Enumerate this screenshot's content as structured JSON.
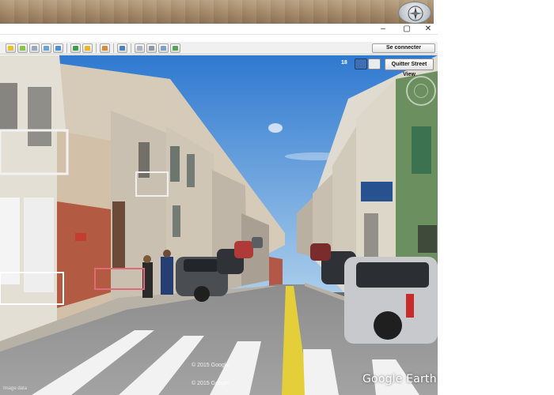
{
  "window": {
    "minimize_label": "–",
    "maximize_label": "▢",
    "close_label": "✕"
  },
  "toolbar": {
    "signin_label": "Se connecter",
    "icons": [
      "push-pin-icon",
      "polygon-icon",
      "path-icon",
      "image-overlay-icon",
      "tour-icon",
      "historical-imagery-icon",
      "sun-icon",
      "planets-icon",
      "ruler-icon",
      "email-icon",
      "print-icon",
      "save-image-icon",
      "google-maps-icon"
    ]
  },
  "streetview": {
    "zoom_level": "18",
    "exit_label": "Quitter Street View",
    "copyright_1": "© 2015 Google",
    "copyright_2": "© 2015 Google",
    "brand": "Google Earth",
    "footer_left": "Image data"
  },
  "colors": {
    "sky": "#3f86d8",
    "road_line": "#e4cf3a",
    "toolbar_bg": "#f0f0f0"
  }
}
